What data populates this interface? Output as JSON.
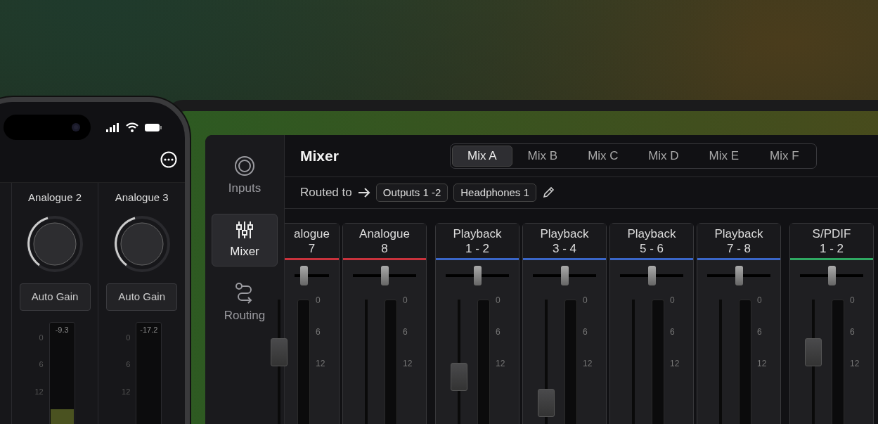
{
  "phone": {
    "channels": [
      {
        "name": "Analogue 2",
        "button": "Auto Gain",
        "meter": {
          "reading": "-9.3",
          "level": 0.25
        },
        "scale": [
          "0",
          "6",
          "12"
        ]
      },
      {
        "name": "Analogue 3",
        "button": "Auto Gain",
        "meter": {
          "reading": "-17.2"
        },
        "scale": [
          "0",
          "6",
          "12"
        ]
      }
    ]
  },
  "sidebar": {
    "items": [
      {
        "label": "Inputs",
        "selected": false
      },
      {
        "label": "Mixer",
        "selected": true
      },
      {
        "label": "Routing",
        "selected": false
      }
    ]
  },
  "mixer": {
    "title": "Mixer",
    "mixes": [
      {
        "label": "Mix A",
        "selected": true
      },
      {
        "label": "Mix B",
        "selected": false
      },
      {
        "label": "Mix C",
        "selected": false
      },
      {
        "label": "Mix D",
        "selected": false
      },
      {
        "label": "Mix E",
        "selected": false
      },
      {
        "label": "Mix F",
        "selected": false
      }
    ],
    "routed_label": "Routed to",
    "outputs": [
      "Outputs 1 -2",
      "Headphones 1"
    ],
    "channels": [
      {
        "name": "alogue",
        "number": "7",
        "color": "#c8323c",
        "pan": {
          "level": 0.2
        },
        "fader": {
          "level": 0.66
        },
        "scale": [
          "0",
          "6",
          "12"
        ]
      },
      {
        "name": "Analogue",
        "number": "8",
        "color": "#c8323c",
        "pan": {
          "level": 0.5
        },
        "scale": [
          "0",
          "6",
          "12"
        ]
      },
      {
        "name": "Playback",
        "number": "1 - 2",
        "color": "#3a66c8",
        "pan": {
          "level": 0.5
        },
        "fader": {
          "level": 0.5
        },
        "scale": [
          "0",
          "6",
          "12"
        ]
      },
      {
        "name": "Playback",
        "number": "3 - 4",
        "color": "#3a66c8",
        "pan": {
          "level": 0.5
        },
        "fader": {
          "level": 0.33
        },
        "scale": [
          "0",
          "6",
          "12"
        ]
      },
      {
        "name": "Playback",
        "number": "5 - 6",
        "color": "#3a66c8",
        "pan": {
          "level": 0.5
        },
        "scale": [
          "0",
          "6",
          "12"
        ]
      },
      {
        "name": "Playback",
        "number": "7 - 8",
        "color": "#3a66c8",
        "pan": {
          "level": 0.5
        },
        "scale": [
          "0",
          "6",
          "12"
        ]
      },
      {
        "name": "S/PDIF",
        "number": "1 - 2",
        "color": "#2fa862",
        "pan": {
          "level": 0.5
        },
        "fader": {
          "level": 0.66
        },
        "scale": [
          "0",
          "6",
          "12"
        ]
      }
    ]
  }
}
